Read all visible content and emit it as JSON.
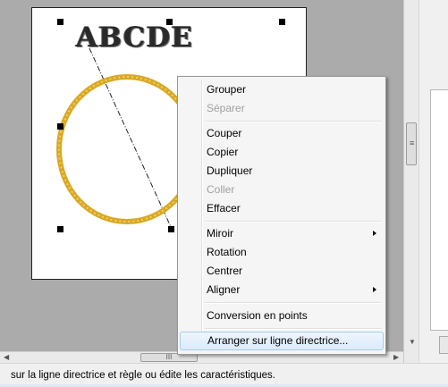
{
  "design": {
    "text_object": "ABCDE",
    "colors": {
      "stitch": "#d9a823",
      "page": "#ffffff",
      "background": "#ababab"
    }
  },
  "context_menu": {
    "items": [
      {
        "label": "Grouper",
        "enabled": true,
        "submenu": false
      },
      {
        "label": "Séparer",
        "enabled": false,
        "submenu": false
      },
      {
        "label": "Couper",
        "enabled": true,
        "submenu": false
      },
      {
        "label": "Copier",
        "enabled": true,
        "submenu": false
      },
      {
        "label": "Dupliquer",
        "enabled": true,
        "submenu": false
      },
      {
        "label": "Coller",
        "enabled": false,
        "submenu": false
      },
      {
        "label": "Effacer",
        "enabled": true,
        "submenu": false
      },
      {
        "label": "Miroir",
        "enabled": true,
        "submenu": true
      },
      {
        "label": "Rotation",
        "enabled": true,
        "submenu": false
      },
      {
        "label": "Centrer",
        "enabled": true,
        "submenu": false
      },
      {
        "label": "Aligner",
        "enabled": true,
        "submenu": true
      },
      {
        "label": "Conversion en points",
        "enabled": true,
        "submenu": false
      },
      {
        "label": "Arranger sur ligne directrice...",
        "enabled": true,
        "submenu": false,
        "highlighted": true
      }
    ]
  },
  "scrollbars": {
    "horizontal_grip": "III",
    "vertical_grip": "≡"
  },
  "status_bar": {
    "text": "sur la ligne directrice et règle ou édite les caractéristiques."
  }
}
